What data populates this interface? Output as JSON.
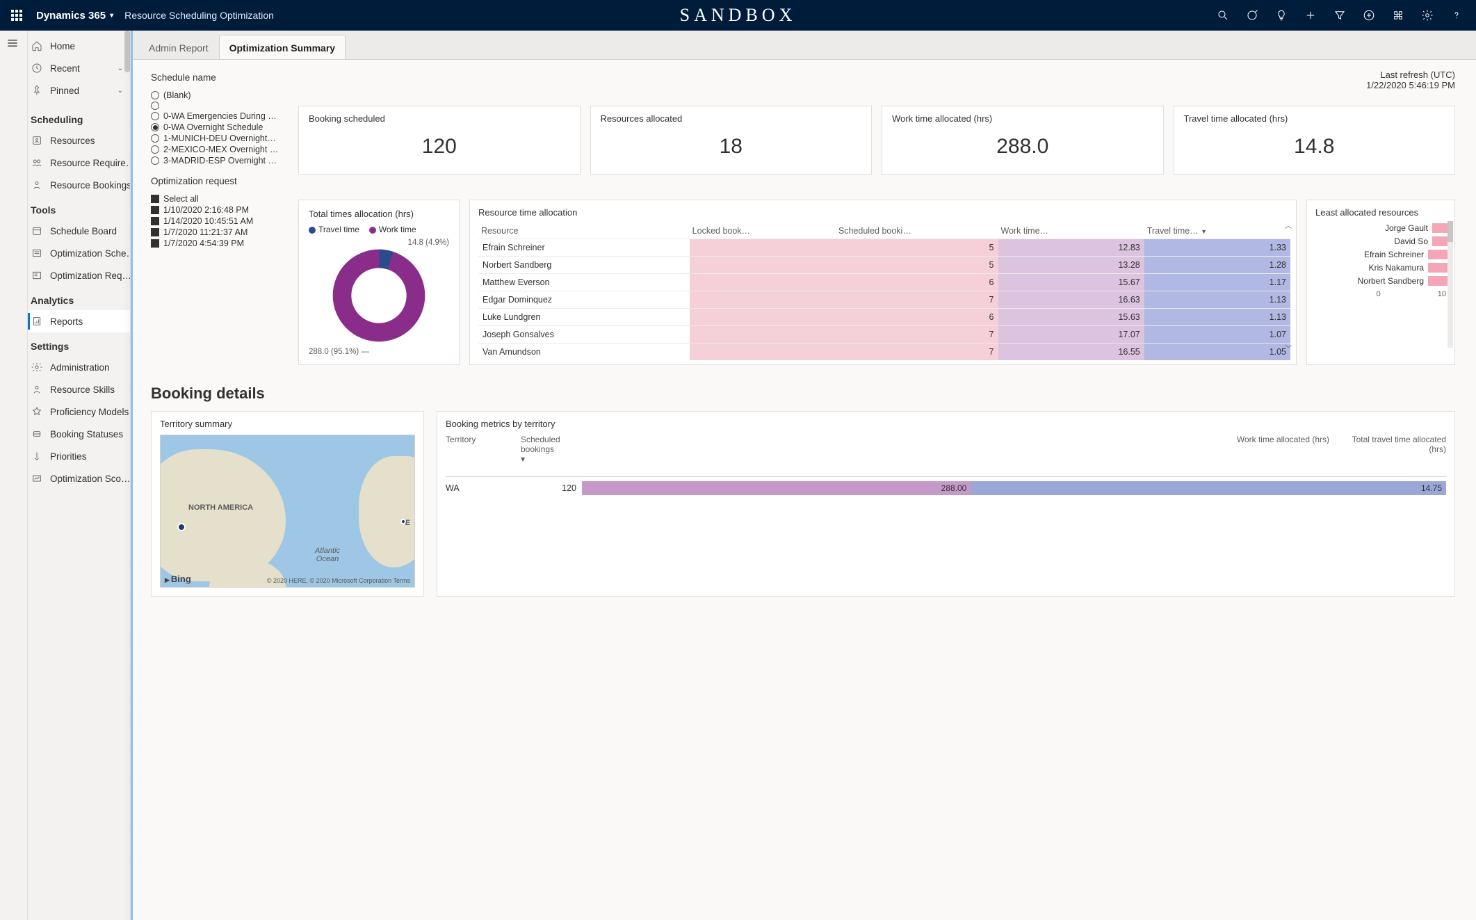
{
  "header": {
    "brand": "Dynamics 365",
    "app_title": "Resource Scheduling Optimization",
    "sandbox": "SANDBOX"
  },
  "sidebar": {
    "top_items": [
      {
        "label": "Home",
        "icon": "home"
      },
      {
        "label": "Recent",
        "icon": "clock",
        "chevron": true
      },
      {
        "label": "Pinned",
        "icon": "pin",
        "chevron": true
      }
    ],
    "sections": [
      {
        "title": "Scheduling",
        "items": [
          {
            "label": "Resources",
            "icon": "resource"
          },
          {
            "label": "Resource Require…",
            "icon": "people"
          },
          {
            "label": "Resource Bookings",
            "icon": "person"
          }
        ]
      },
      {
        "title": "Tools",
        "items": [
          {
            "label": "Schedule Board",
            "icon": "calendar"
          },
          {
            "label": "Optimization Sche…",
            "icon": "list"
          },
          {
            "label": "Optimization Req…",
            "icon": "list2"
          }
        ]
      },
      {
        "title": "Analytics",
        "items": [
          {
            "label": "Reports",
            "icon": "report",
            "active": true
          }
        ]
      },
      {
        "title": "Settings",
        "items": [
          {
            "label": "Administration",
            "icon": "gear"
          },
          {
            "label": "Resource Skills",
            "icon": "skill"
          },
          {
            "label": "Proficiency Models",
            "icon": "star"
          },
          {
            "label": "Booking Statuses",
            "icon": "status"
          },
          {
            "label": "Priorities",
            "icon": "priority"
          },
          {
            "label": "Optimization Sco…",
            "icon": "score"
          }
        ]
      }
    ]
  },
  "tabs": [
    {
      "label": "Admin Report",
      "active": false
    },
    {
      "label": "Optimization Summary",
      "active": true
    }
  ],
  "refresh": {
    "label": "Last refresh (UTC)",
    "value": "1/22/2020 5:46:19 PM"
  },
  "filters": {
    "schedule_label": "Schedule name",
    "schedules": [
      {
        "label": "(Blank)",
        "selected": false
      },
      {
        "label": "",
        "selected": false
      },
      {
        "label": "0-WA Emergencies During …",
        "selected": false
      },
      {
        "label": "0-WA Overnight Schedule",
        "selected": true
      },
      {
        "label": "1-MUNICH-DEU Overnight…",
        "selected": false
      },
      {
        "label": "2-MEXICO-MEX Overnight …",
        "selected": false
      },
      {
        "label": "3-MADRID-ESP Overnight …",
        "selected": false
      }
    ],
    "opt_label": "Optimization request",
    "opt_items": [
      {
        "label": "Select all"
      },
      {
        "label": "1/10/2020 2:16:48 PM"
      },
      {
        "label": "1/14/2020 10:45:51 AM"
      },
      {
        "label": "1/7/2020 11:21:37 AM"
      },
      {
        "label": "1/7/2020 4:54:39 PM"
      }
    ]
  },
  "kpis": [
    {
      "label": "Booking scheduled",
      "value": "120"
    },
    {
      "label": "Resources allocated",
      "value": "18"
    },
    {
      "label": "Work time allocated (hrs)",
      "value": "288.0"
    },
    {
      "label": "Travel time allocated (hrs)",
      "value": "14.8"
    }
  ],
  "chart_data": {
    "donut": {
      "type": "pie",
      "title": "Total times allocation (hrs)",
      "legend": [
        "Travel time",
        "Work time"
      ],
      "colors": [
        "#2a4b8d",
        "#8a2d8a"
      ],
      "series": [
        {
          "name": "Travel time",
          "value": 14.8,
          "pct": "4.9%",
          "label": "14.8 (4.9%)"
        },
        {
          "name": "Work time",
          "value": 288.0,
          "pct": "95.1%",
          "label": "288.0 (95.1%)"
        }
      ]
    },
    "resource_table": {
      "title": "Resource time allocation",
      "columns": [
        "Resource",
        "Locked book…",
        "Scheduled booki…",
        "Work time…",
        "Travel time…"
      ],
      "rows": [
        {
          "resource": "Efrain Schreiner",
          "locked": "",
          "scheduled": 5,
          "work": 12.83,
          "travel": 1.33
        },
        {
          "resource": "Norbert Sandberg",
          "locked": "",
          "scheduled": 5,
          "work": 13.28,
          "travel": 1.28
        },
        {
          "resource": "Matthew Everson",
          "locked": "",
          "scheduled": 6,
          "work": 15.67,
          "travel": 1.17
        },
        {
          "resource": "Edgar Dominquez",
          "locked": "",
          "scheduled": 7,
          "work": 16.63,
          "travel": 1.13
        },
        {
          "resource": "Luke Lundgren",
          "locked": "",
          "scheduled": 6,
          "work": 15.63,
          "travel": 1.13
        },
        {
          "resource": "Joseph Gonsalves",
          "locked": "",
          "scheduled": 7,
          "work": 17.07,
          "travel": 1.07
        },
        {
          "resource": "Van Amundson",
          "locked": "",
          "scheduled": 7,
          "work": 16.55,
          "travel": 1.05
        }
      ]
    },
    "least_resources": {
      "type": "bar",
      "title": "Least allocated resources",
      "orientation": "horizontal",
      "xlim": [
        0,
        10
      ],
      "xticks": [
        0,
        10
      ],
      "color": "#f4a6b6",
      "categories": [
        "Jorge Gault",
        "David So",
        "Efrain Schreiner",
        "Kris Nakamura",
        "Norbert Sandberg"
      ],
      "values": [
        4,
        4,
        5,
        5,
        5
      ]
    },
    "territory": {
      "title": "Booking metrics by territory",
      "columns": [
        "Territory",
        "Scheduled bookings",
        "Work time allocated (hrs)",
        "Total travel time allocated (hrs)"
      ],
      "rows": [
        {
          "territory": "WA",
          "scheduled": 120,
          "work": 288.0,
          "travel": 14.75
        }
      ]
    }
  },
  "booking_heading": "Booking details",
  "map": {
    "title": "Territory summary",
    "label_na": "NORTH AMERICA",
    "label_ocean": "Atlantic Ocean",
    "label_eu": "E",
    "bing": "Bing",
    "attrib": "© 2020 HERE, © 2020 Microsoft Corporation  Terms"
  }
}
